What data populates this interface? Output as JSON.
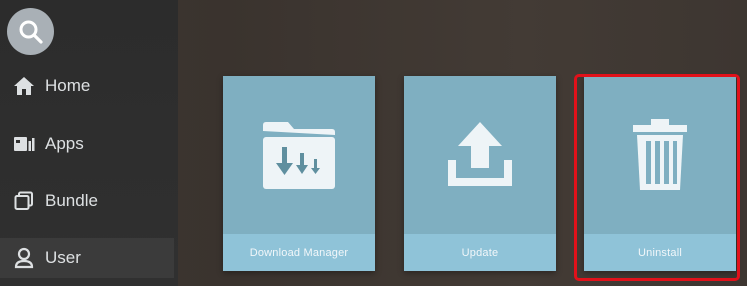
{
  "sidebar": {
    "search_icon": "search-icon",
    "items": [
      {
        "label": "Home",
        "icon": "home-icon"
      },
      {
        "label": "Apps",
        "icon": "apps-icon"
      },
      {
        "label": "Bundle",
        "icon": "bundle-icon"
      },
      {
        "label": "User",
        "icon": "user-icon",
        "active": true
      }
    ]
  },
  "tiles": [
    {
      "label": "Download Manager",
      "icon": "download-folder-icon"
    },
    {
      "label": "Update",
      "icon": "upload-icon"
    },
    {
      "label": "Uninstall",
      "icon": "trash-icon",
      "highlighted": true
    }
  ],
  "colors": {
    "tile": "#7fafc1",
    "caption": "#8fc3d8",
    "highlight": "#e1111a"
  }
}
